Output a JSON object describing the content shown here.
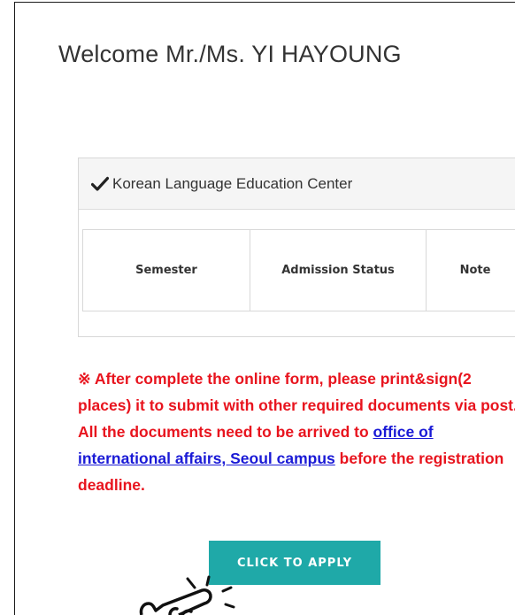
{
  "welcome_text": "Welcome Mr./Ms. YI HAYOUNG",
  "card": {
    "header_icon": "checkmark-icon",
    "header_title": "Korean Language Education Center",
    "columns": [
      "Semester",
      "Admission Status",
      "Note"
    ]
  },
  "notice": {
    "part1": "※ After complete the online form, please print&sign(2 places) it to submit with other required documents via post. All the documents need to be arrived to ",
    "link_text": "office of international affairs, Seoul campus",
    "part2": " before the registration deadline.",
    "color": "#e8141e",
    "link_color": "#1a1ad6"
  },
  "apply_button": {
    "label": "CLICK TO APPLY",
    "color": "#1fa9a8"
  },
  "pointer_icon": "pointing-hand-icon"
}
